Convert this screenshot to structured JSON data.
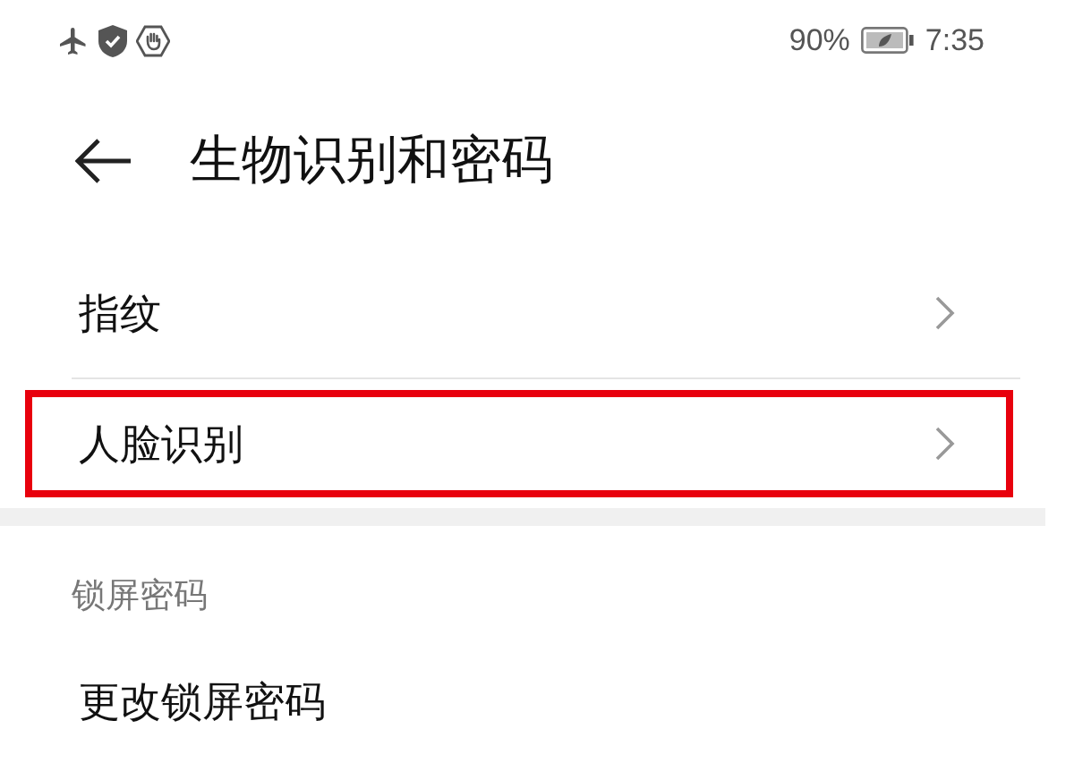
{
  "status_bar": {
    "battery": "90%",
    "time": "7:35"
  },
  "header": {
    "title": "生物识别和密码"
  },
  "groups": [
    {
      "items": [
        {
          "label": "指纹",
          "highlighted": false
        },
        {
          "label": "人脸识别",
          "highlighted": true
        }
      ]
    },
    {
      "heading": "锁屏密码",
      "items": [
        {
          "label": "更改锁屏密码",
          "highlighted": false
        }
      ]
    }
  ]
}
